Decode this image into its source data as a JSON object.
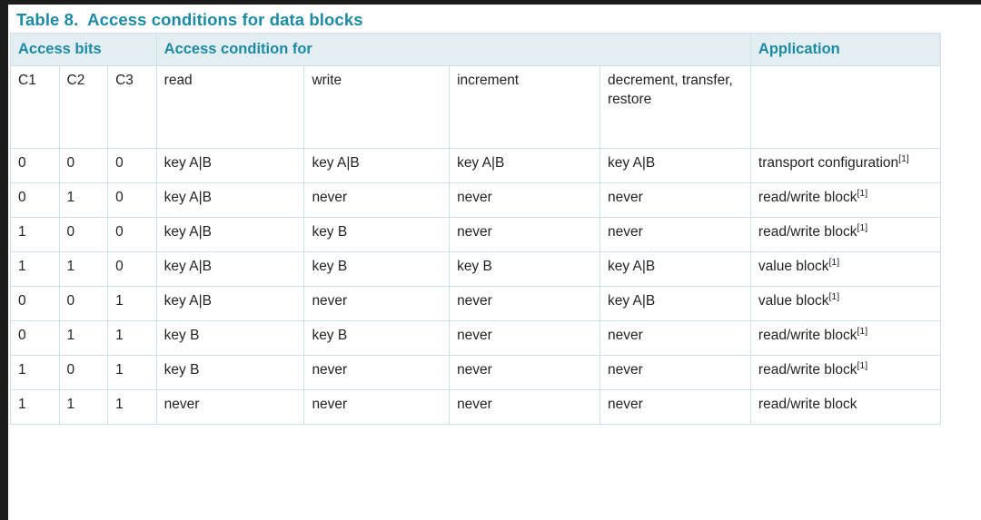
{
  "title": "Table 8.  Access conditions for data blocks",
  "header": {
    "group_access_bits": "Access bits",
    "group_access_condition": "Access condition for",
    "group_application": "Application",
    "columns": {
      "c1": "C1",
      "c2": "C2",
      "c3": "C3",
      "read": "read",
      "write": "write",
      "increment": "increment",
      "decrement": "decrement, transfer, restore",
      "application": ""
    }
  },
  "rows": [
    {
      "c1": "0",
      "c2": "0",
      "c3": "0",
      "read": "key A|B",
      "write": "key A|B",
      "increment": "key A|B",
      "decrement": "key A|B",
      "application": "transport configuration",
      "application_note": "[1]"
    },
    {
      "c1": "0",
      "c2": "1",
      "c3": "0",
      "read": "key A|B",
      "write": "never",
      "increment": "never",
      "decrement": "never",
      "application": "read/write block",
      "application_note": "[1]"
    },
    {
      "c1": "1",
      "c2": "0",
      "c3": "0",
      "read": "key A|B",
      "write": "key B",
      "increment": "never",
      "decrement": "never",
      "application": "read/write block",
      "application_note": "[1]"
    },
    {
      "c1": "1",
      "c2": "1",
      "c3": "0",
      "read": "key A|B",
      "write": "key B",
      "increment": "key B",
      "decrement": "key A|B",
      "application": "value block",
      "application_note": "[1]"
    },
    {
      "c1": "0",
      "c2": "0",
      "c3": "1",
      "read": "key A|B",
      "write": "never",
      "increment": "never",
      "decrement": "key A|B",
      "application": "value block",
      "application_note": "[1]"
    },
    {
      "c1": "0",
      "c2": "1",
      "c3": "1",
      "read": "key B",
      "write": "key B",
      "increment": "never",
      "decrement": "never",
      "application": "read/write block",
      "application_note": "[1]"
    },
    {
      "c1": "1",
      "c2": "0",
      "c3": "1",
      "read": "key B",
      "write": "never",
      "increment": "never",
      "decrement": "never",
      "application": "read/write block",
      "application_note": "[1]"
    },
    {
      "c1": "1",
      "c2": "1",
      "c3": "1",
      "read": "never",
      "write": "never",
      "increment": "never",
      "decrement": "never",
      "application": "read/write block",
      "application_note": ""
    }
  ],
  "colors": {
    "accent": "#1d8aa3",
    "header_bg": "#e2eef1",
    "border": "#cfe0e6",
    "text": "#231f20",
    "page_edge": "#1c1c1c"
  }
}
